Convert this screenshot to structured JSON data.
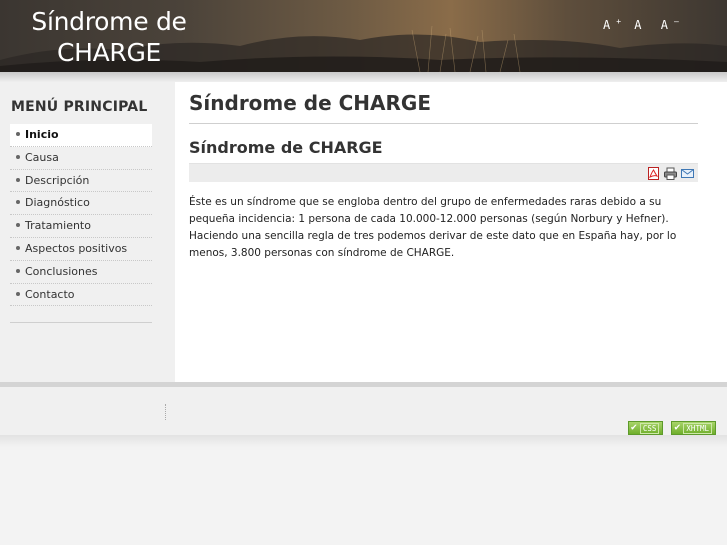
{
  "header": {
    "site_title": "Síndrome de CHARGE",
    "font_controls": [
      "A",
      "A",
      "A"
    ],
    "font_controls_sup": [
      "+",
      "",
      "–"
    ]
  },
  "sidebar": {
    "heading": "MENÚ PRINCIPAL",
    "items": [
      {
        "label": "Inicio",
        "active": true
      },
      {
        "label": "Causa"
      },
      {
        "label": "Descripción"
      },
      {
        "label": "Diagnóstico"
      },
      {
        "label": "Tratamiento"
      },
      {
        "label": "Aspectos positivos"
      },
      {
        "label": "Conclusiones"
      },
      {
        "label": "Contacto"
      }
    ]
  },
  "main": {
    "page_title": "Síndrome de CHARGE",
    "article_title": "Síndrome de CHARGE",
    "tools": [
      "pdf-icon",
      "print-icon",
      "email-icon"
    ],
    "body": "Éste es un síndrome que se engloba dentro del grupo de enfermedades raras debido a su pequeña incidencia: 1 persona de cada 10.000-12.000 personas (según Norbury y Hefner). Haciendo una sencilla regla de tres podemos derivar de este dato que en España hay, por lo menos, 3.800 personas con síndrome de CHARGE."
  },
  "footer": {
    "badges": [
      {
        "label": "CSS",
        "icon": "checkmark-icon"
      },
      {
        "label": "XHTML",
        "icon": "checkmark-icon"
      }
    ]
  },
  "colors": {
    "badge_green": "#6fae2b",
    "header_dark": "#3b3631",
    "header_warm": "#8a6c49"
  }
}
